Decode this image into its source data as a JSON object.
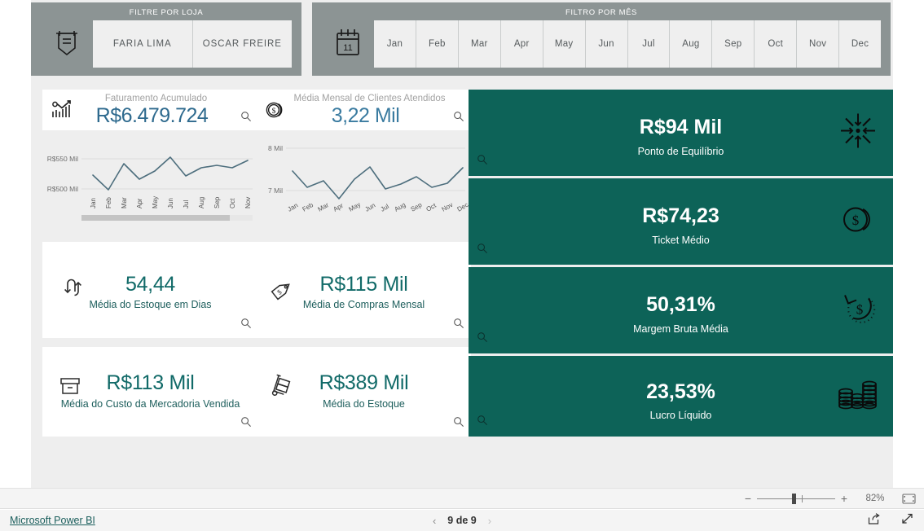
{
  "store_filter": {
    "title": "FILTRE POR LOJA",
    "icon": "banner-filter-icon",
    "options": [
      "FARIA LIMA",
      "OSCAR FREIRE"
    ]
  },
  "month_filter": {
    "title": "FILTRO POR MÊS",
    "icon": "calendar-icon",
    "icon_day": "11",
    "options": [
      "Jan",
      "Feb",
      "Mar",
      "Apr",
      "May",
      "Jun",
      "Jul",
      "Aug",
      "Sep",
      "Oct",
      "Nov",
      "Dec"
    ]
  },
  "chart_cards": [
    {
      "icon": "bar-chart-growth-icon",
      "title": "Faturamento Acumulado",
      "value": "R$6.479.724",
      "magnifier": "search-icon"
    },
    {
      "icon": "coin-dollar-icon",
      "title": "Média Mensal de Clientes Atendidos",
      "value": "3,22 Mil",
      "magnifier": "search-icon"
    }
  ],
  "kpi_cards": [
    {
      "icon": "swap-arrows-icon",
      "value": "54,44",
      "label": "Média do Estoque em Dias",
      "magnifier": "search-icon"
    },
    {
      "icon": "price-tag-icon",
      "value": "R$115 Mil",
      "label": "Média de Compras Mensal",
      "magnifier": "search-icon"
    },
    {
      "icon": "box-archive-icon",
      "value": "R$113 Mil",
      "label": "Média do Custo da Mercadoria Vendida",
      "magnifier": "search-icon"
    },
    {
      "icon": "hand-truck-icon",
      "value": "R$389 Mil",
      "label": "Média do Estoque",
      "magnifier": "search-icon"
    }
  ],
  "teal_cards": [
    {
      "icon": "converge-target-icon",
      "value": "R$94 Mil",
      "label": "Ponto de Equilíbrio",
      "magnifier": "search-icon"
    },
    {
      "icon": "coins-dollar-icon",
      "value": "R$74,23",
      "label": "Ticket Médio",
      "magnifier": "search-icon"
    },
    {
      "icon": "dollar-refresh-icon",
      "value": "50,31%",
      "label": "Margem Bruta Média",
      "magnifier": "search-icon"
    },
    {
      "icon": "coin-stacks-icon",
      "value": "23,53%",
      "label": "Lucro Líquido",
      "magnifier": "search-icon"
    }
  ],
  "colors": {
    "teal_card": "#0d6358",
    "kpi_value_teal": "#116a68",
    "chart_value_blue": "#2e6a8e",
    "spark_line": "#4d6e7d",
    "filter_bar": "#8c9494"
  },
  "chart_data": [
    {
      "type": "line",
      "title": "Faturamento Acumulado",
      "x": [
        "Jan",
        "Feb",
        "Mar",
        "Apr",
        "May",
        "Jun",
        "Jul",
        "Aug",
        "Sep",
        "Oct",
        "Nov"
      ],
      "values": [
        528,
        503,
        546,
        519,
        532,
        552,
        526,
        538,
        541,
        538,
        547
      ],
      "ylabel": "",
      "xlabel": "",
      "ytick_labels": [
        "R$500 Mil",
        "R$550 Mil"
      ],
      "ytick_values": [
        500,
        550
      ],
      "ylim": [
        495,
        560
      ],
      "grid": true,
      "legend": "none",
      "unit": "R$ Mil",
      "scrollbar": true
    },
    {
      "type": "line",
      "title": "Média Mensal de Clientes Atendidos",
      "x": [
        "Jan",
        "Feb",
        "Mar",
        "Apr",
        "May",
        "Jun",
        "Jul",
        "Aug",
        "Sep",
        "Oct",
        "Nov",
        "Dec"
      ],
      "values": [
        7.45,
        7.1,
        7.25,
        6.85,
        7.3,
        7.63,
        7.05,
        7.2,
        7.35,
        7.12,
        7.2,
        7.6
      ],
      "ylabel": "",
      "xlabel": "",
      "ytick_labels": [
        "7 Mil",
        "8 Mil"
      ],
      "ytick_values": [
        7,
        8
      ],
      "ylim": [
        6.7,
        8.05
      ],
      "grid": true,
      "legend": "none",
      "unit": "Mil",
      "scrollbar": false
    }
  ],
  "zoombar": {
    "minus": "−",
    "plus": "+",
    "percent": "82%",
    "fit_icon": "fit-to-page-icon"
  },
  "statusbar": {
    "brand": "Microsoft Power BI",
    "prev_icon": "chevron-left-icon",
    "next_icon": "chevron-right-icon",
    "page_label": "9 de 9",
    "share_icon": "share-icon",
    "fullscreen_icon": "fullscreen-icon"
  }
}
